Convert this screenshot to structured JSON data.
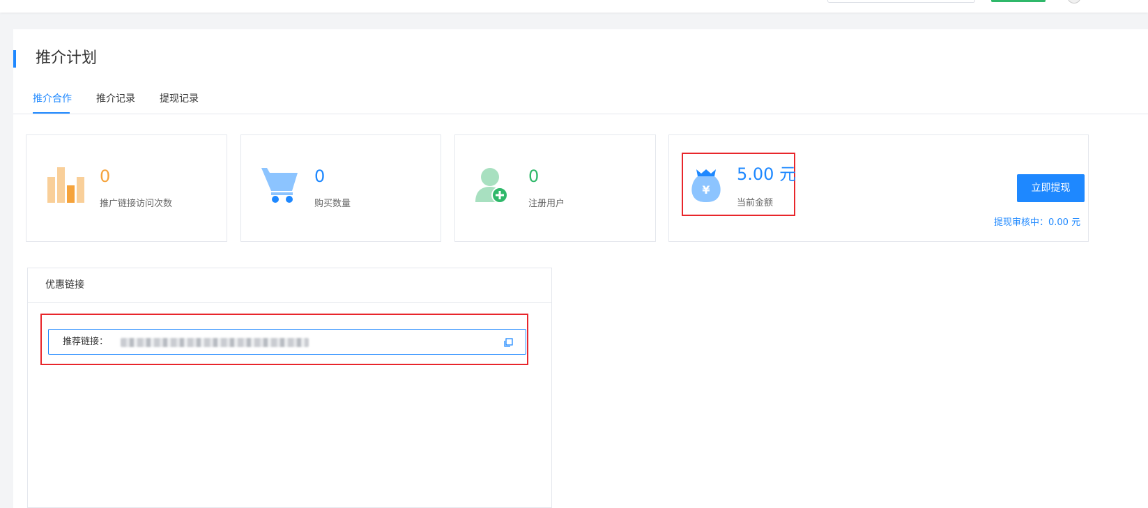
{
  "page": {
    "title": "推介计划"
  },
  "tabs": [
    {
      "label": "推介合作",
      "active": true
    },
    {
      "label": "推介记录",
      "active": false
    },
    {
      "label": "提现记录",
      "active": false
    }
  ],
  "stats": {
    "visits": {
      "value": "0",
      "label": "推广链接访问次数",
      "icon": "bar-chart-icon",
      "color": "#f5a33c"
    },
    "purchases": {
      "value": "0",
      "label": "购买数量",
      "icon": "cart-icon",
      "color": "#1e88ff"
    },
    "registered": {
      "value": "0",
      "label": "注册用户",
      "icon": "add-user-icon",
      "color": "#2fb86a"
    }
  },
  "balance": {
    "amount": "5.00 元",
    "label": "当前金额",
    "icon": "money-bag-icon",
    "withdraw_button": "立即提现",
    "pending": "提现审核中：0.00 元"
  },
  "discount": {
    "title": "优惠链接",
    "link_label": "推荐链接：",
    "copy_icon": "copy-icon"
  },
  "colors": {
    "accent": "#1e88ff",
    "highlight": "#e8262b"
  }
}
